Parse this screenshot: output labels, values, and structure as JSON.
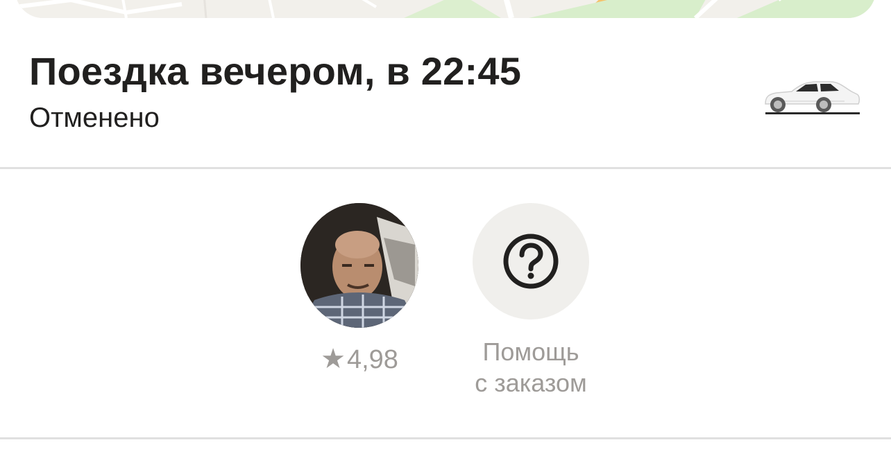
{
  "ride": {
    "title": "Поездка вечером, в 22:45",
    "status": "Отменено",
    "car_icon": "car-icon"
  },
  "driver": {
    "rating_star": "★",
    "rating": "4,98",
    "avatar_icon": "driver-photo"
  },
  "help": {
    "line1": "Помощь",
    "line2": "с заказом",
    "icon": "question-mark-icon"
  },
  "colors": {
    "text_primary": "#21201f",
    "text_secondary": "#9e9b98",
    "divider": "#e0e0e0",
    "help_bg": "#f0efec"
  }
}
